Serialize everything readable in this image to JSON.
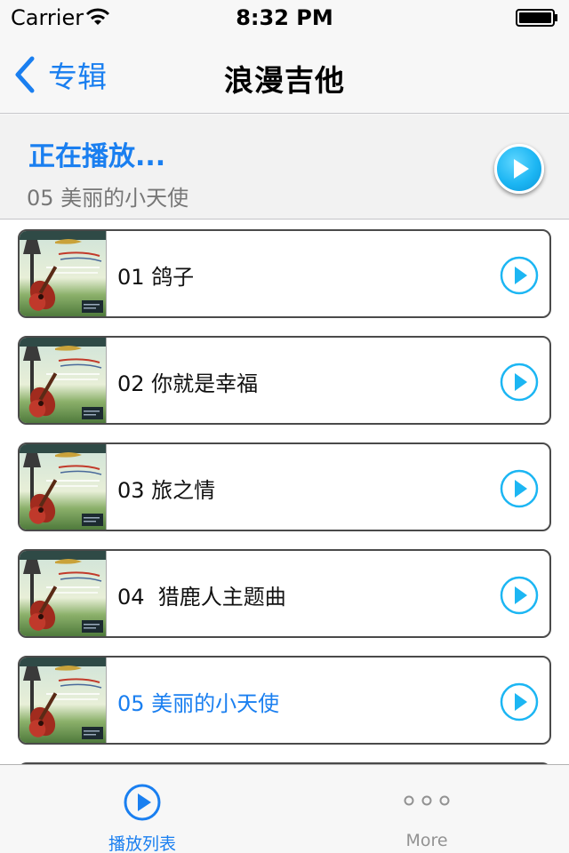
{
  "status_bar": {
    "carrier": "Carrier",
    "time": "8:32 PM",
    "wifi_icon": "wifi-icon",
    "battery_icon": "battery-full-icon"
  },
  "nav": {
    "back_label": "专辑",
    "title": "浪漫吉他"
  },
  "now_playing": {
    "title": "正在播放...",
    "track": "05 美丽的小天使"
  },
  "tracks": [
    {
      "label": "01 鸽子",
      "active": false
    },
    {
      "label": "02 你就是幸福",
      "active": false
    },
    {
      "label": "03 旅之情",
      "active": false
    },
    {
      "label": "04  猎鹿人主题曲",
      "active": false
    },
    {
      "label": "05 美丽的小天使",
      "active": true
    },
    {
      "label": "",
      "active": false
    }
  ],
  "tab_bar": {
    "items": [
      {
        "label": "播放列表",
        "icon": "play-circle-icon",
        "selected": true
      },
      {
        "label": "More",
        "icon": "more-dots-icon",
        "selected": false
      }
    ]
  },
  "colors": {
    "accent": "#1a7ff0",
    "play_button": "#1cb6f3",
    "inactive_tab": "#929292"
  }
}
